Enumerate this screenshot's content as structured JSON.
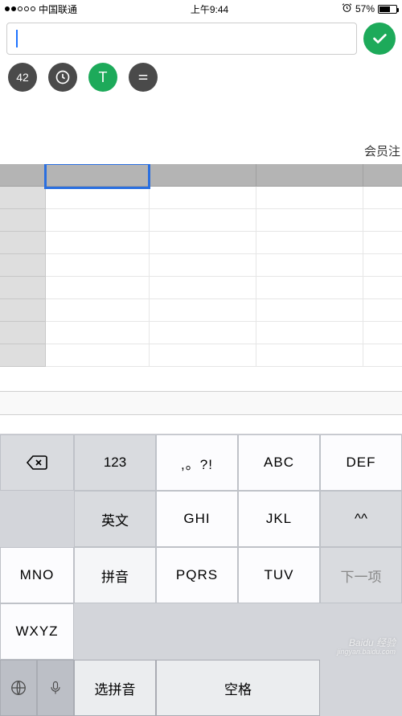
{
  "status_bar": {
    "carrier": "中国联通",
    "time": "上午9:44",
    "battery_pct": "57%",
    "alarm_icon": "⏰"
  },
  "input": {
    "value": "",
    "placeholder": ""
  },
  "toolbar": {
    "number_pill": "42",
    "clock_icon": "clock",
    "t_icon": "T",
    "equals_icon": "="
  },
  "sheet": {
    "title_fragment": "会员注"
  },
  "keyboard": {
    "row1": [
      "123",
      ",。?!",
      "ABC",
      "DEF"
    ],
    "row2": [
      "英文",
      "GHI",
      "JKL",
      "MNO",
      "^^"
    ],
    "row3": [
      "拼音",
      "PQRS",
      "TUV",
      "WXYZ"
    ],
    "backspace": "⌫",
    "next": "下一项",
    "bottom": {
      "globe": "globe",
      "mic": "mic",
      "select_pinyin": "选拼音",
      "space": "空格"
    }
  },
  "watermark": {
    "brand": "Baidu 经验",
    "url": "jingyan.baidu.com"
  }
}
